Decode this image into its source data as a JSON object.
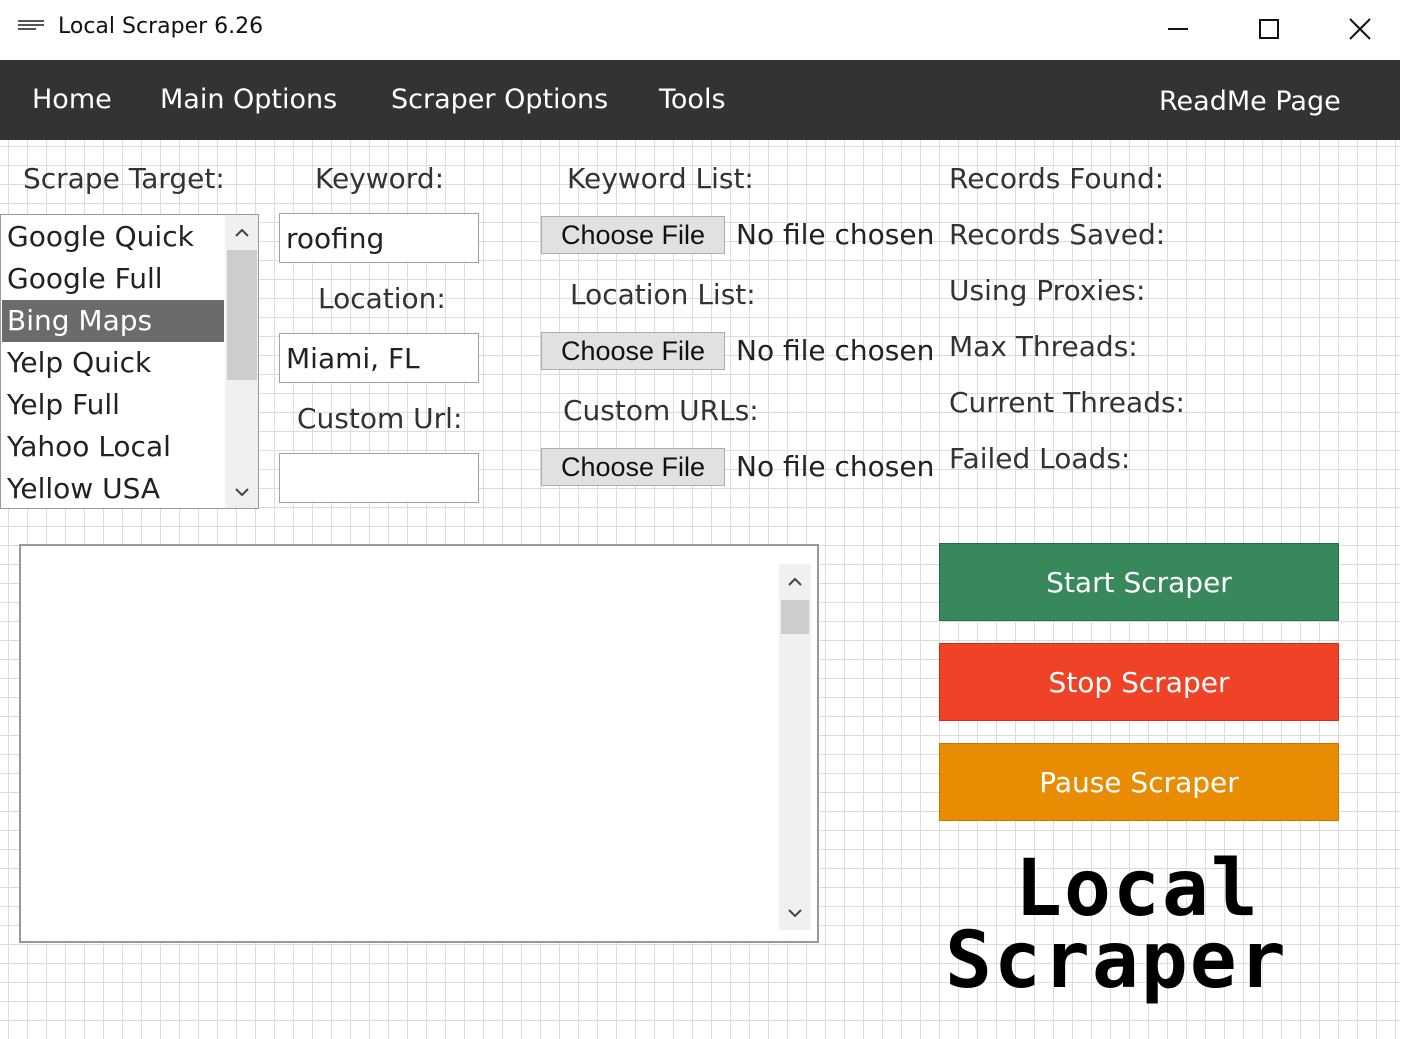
{
  "window": {
    "title": "Local Scraper 6.26"
  },
  "nav": {
    "items": [
      {
        "label": "Home"
      },
      {
        "label": "Main Options"
      },
      {
        "label": "Scraper Options"
      },
      {
        "label": "Tools"
      }
    ],
    "readme": "ReadMe Page"
  },
  "form": {
    "scrape_target_label": "Scrape Target:",
    "targets": [
      "Google Quick",
      "Google Full",
      "Bing Maps",
      "Yelp Quick",
      "Yelp Full",
      "Yahoo Local",
      "Yellow USA"
    ],
    "selected_target": "Bing Maps",
    "keyword_label": "Keyword:",
    "keyword_value": "roofing",
    "location_label": "Location:",
    "location_value": "Miami, FL",
    "custom_url_label": "Custom Url:",
    "custom_url_value": "",
    "keyword_list_label": "Keyword List:",
    "location_list_label": "Location List:",
    "custom_urls_label": "Custom URLs:",
    "choose_file": "Choose File",
    "no_file": "No file chosen"
  },
  "stats": {
    "records_found": "Records Found:",
    "records_saved": "Records Saved:",
    "using_proxies": "Using Proxies:",
    "max_threads": "Max Threads:",
    "current_threads": "Current Threads:",
    "failed_loads": "Failed Loads:"
  },
  "actions": {
    "start": "Start Scraper",
    "stop": "Stop Scraper",
    "pause": "Pause Scraper"
  },
  "logo": {
    "line1": "Local",
    "line2": "Scraper"
  },
  "colors": {
    "nav_bg": "#333333",
    "start": "#37885a",
    "stop": "#ef4226",
    "pause": "#e88c04",
    "selected": "#6b6b6b"
  }
}
